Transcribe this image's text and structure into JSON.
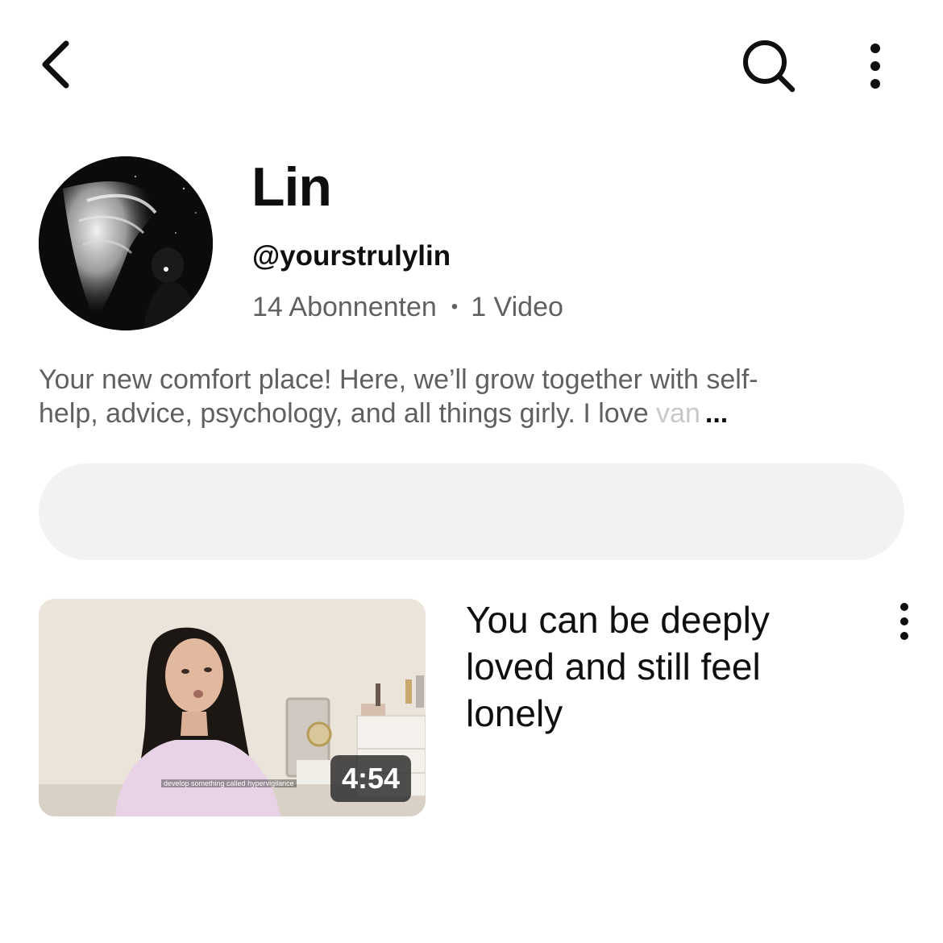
{
  "header": {
    "back_icon": "chevron-left-icon",
    "search_icon": "search-icon",
    "more_icon": "more-vertical-icon"
  },
  "channel": {
    "name": "Lin",
    "handle": "@yourstrulylin",
    "subscribers": "14 Abonnenten",
    "separator": "•",
    "videos": "1 Video",
    "description_line1": "Your new comfort place! Here, we’ll grow together with self-",
    "description_line2": "help, advice, psychology, and all things girly. I love ",
    "description_fade": "van",
    "description_more": "..."
  },
  "video": {
    "title": "You can be deeply loved and still feel lonely",
    "duration": "4:54",
    "caption": "develop something called hypervigilance",
    "more_icon": "more-vertical-icon"
  }
}
